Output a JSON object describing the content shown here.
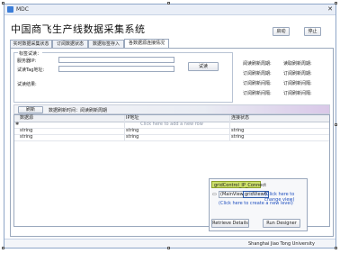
{
  "window": {
    "title": "MDC"
  },
  "app": {
    "heading": "中国商飞生产线数据采集系统"
  },
  "toolbar": {
    "start_label": "启动",
    "stop_label": "停止"
  },
  "tabs": [
    {
      "label": "实时数据采集状态",
      "active": false
    },
    {
      "label": "订阅数据状态",
      "active": false
    },
    {
      "label": "数据标签存入",
      "active": false
    },
    {
      "label": "各数据源连接情况",
      "active": true
    }
  ],
  "test_group": {
    "legend": "标签试读：",
    "server_label": "服务器IP:",
    "tag_label": "试读Tag地址:",
    "result_label": "试读结果:",
    "server_value": "",
    "tag_value": "",
    "test_button": "试读"
  },
  "subscription_stats": [
    {
      "label": "阅读刷新周期:",
      "value": ""
    },
    {
      "label": "读取刷新周期:",
      "value": ""
    },
    {
      "label": "订阅刷新周期:",
      "value": ""
    },
    {
      "label": "订阅刷新周期:",
      "value": ""
    },
    {
      "label": "订阅刷新间隔:",
      "value": ""
    },
    {
      "label": "订阅刷新间隔:",
      "value": ""
    },
    {
      "label": "订阅刷新间隔:",
      "value": ""
    },
    {
      "label": "订阅刷新间隔:",
      "value": ""
    }
  ],
  "grid_toolbar": {
    "refresh_label": "刷新",
    "interval_text": "数据刷新时间：阅读刷新周期"
  },
  "grid": {
    "columns": [
      "数据源",
      "IP地址",
      "连接状态"
    ],
    "new_row_text": "Click here to add a new row",
    "rows": [
      [
        "string",
        "string",
        "string"
      ],
      [
        "string",
        "string",
        "string"
      ]
    ]
  },
  "designer": {
    "title": "gridControl_IP_Connect",
    "mainview": "(MainView)",
    "gridview": "gridView6",
    "change_view": "(Click here to change view)",
    "create_level": "(Click here to create a new level)",
    "retrieve_button": "Retrieve Details",
    "run_button": "Run Designer"
  },
  "statusbar": {
    "text": "Shanghai Jiao Tong University"
  }
}
